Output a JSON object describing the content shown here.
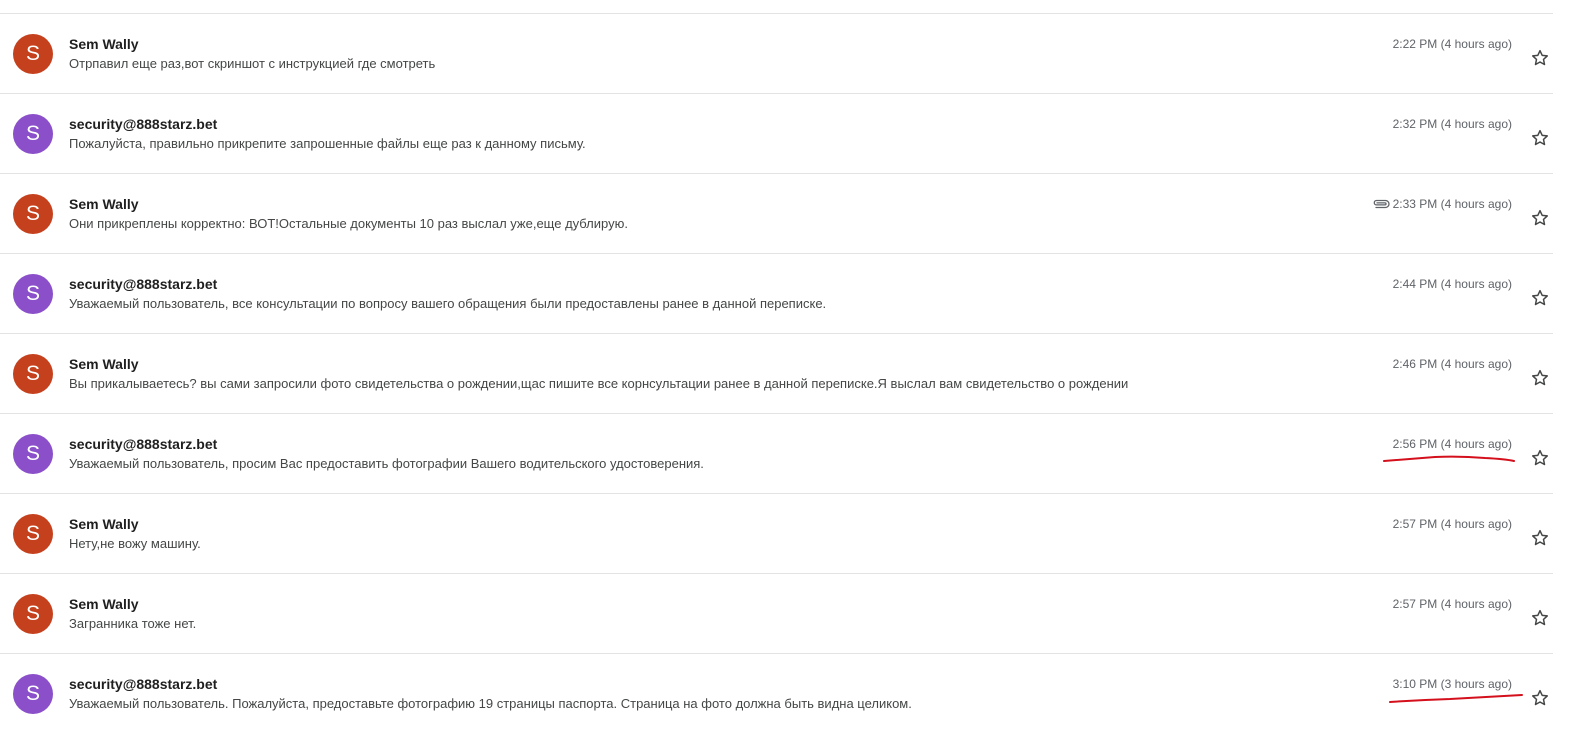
{
  "colors": {
    "sem_avatar": "#c5401d",
    "security_avatar": "#8a4fc9",
    "annotation": "#d4101c"
  },
  "messages": [
    {
      "sender": "Sem Wally",
      "initial": "S",
      "type": "sem",
      "snippet": "Отрпавил еще раз,вот скриншот с инструкцией где смотреть",
      "time": "2:22 PM (4 hours ago)",
      "attachment": false,
      "underlined": false
    },
    {
      "sender": "security@888starz.bet",
      "initial": "S",
      "type": "security",
      "snippet": "Пожалуйста, правильно прикрепите запрошенные файлы еще раз к данному письму.",
      "time": "2:32 PM (4 hours ago)",
      "attachment": false,
      "underlined": false
    },
    {
      "sender": "Sem Wally",
      "initial": "S",
      "type": "sem",
      "snippet": "Они прикреплены корректно: ВОТ!Остальные документы 10 раз выслал уже,еще дублирую.",
      "time": "2:33 PM (4 hours ago)",
      "attachment": true,
      "underlined": false
    },
    {
      "sender": "security@888starz.bet",
      "initial": "S",
      "type": "security",
      "snippet": "Уважаемый пользователь, все консультации по вопросу вашего обращения были предоставлены ранее в данной переписке.",
      "time": "2:44 PM (4 hours ago)",
      "attachment": false,
      "underlined": false
    },
    {
      "sender": "Sem Wally",
      "initial": "S",
      "type": "sem",
      "snippet": "Вы прикалываетесь? вы сами запросили фото свидетельства о рождении,щас пишите все корнсультации ранее в данной переписке.Я выслал вам свидетельство о рождении",
      "time": "2:46 PM (4 hours ago)",
      "attachment": false,
      "underlined": false
    },
    {
      "sender": "security@888starz.bet",
      "initial": "S",
      "type": "security",
      "snippet": "Уважаемый пользователь, просим Вас предоставить фотографии Вашего водительского удостоверения.",
      "time": "2:56 PM (4 hours ago)",
      "attachment": false,
      "underlined": true
    },
    {
      "sender": "Sem Wally",
      "initial": "S",
      "type": "sem",
      "snippet": "Нету,не вожу машину.",
      "time": "2:57 PM (4 hours ago)",
      "attachment": false,
      "underlined": false
    },
    {
      "sender": "Sem Wally",
      "initial": "S",
      "type": "sem",
      "snippet": "Загранника тоже нет.",
      "time": "2:57 PM (4 hours ago)",
      "attachment": false,
      "underlined": false
    },
    {
      "sender": "security@888starz.bet",
      "initial": "S",
      "type": "security",
      "snippet": "Уважаемый пользователь. Пожалуйста, предоставьте фотографию 19 страницы паспорта. Страница на фото должна быть видна целиком.",
      "time": "3:10 PM (3 hours ago)",
      "attachment": false,
      "underlined": true
    }
  ]
}
